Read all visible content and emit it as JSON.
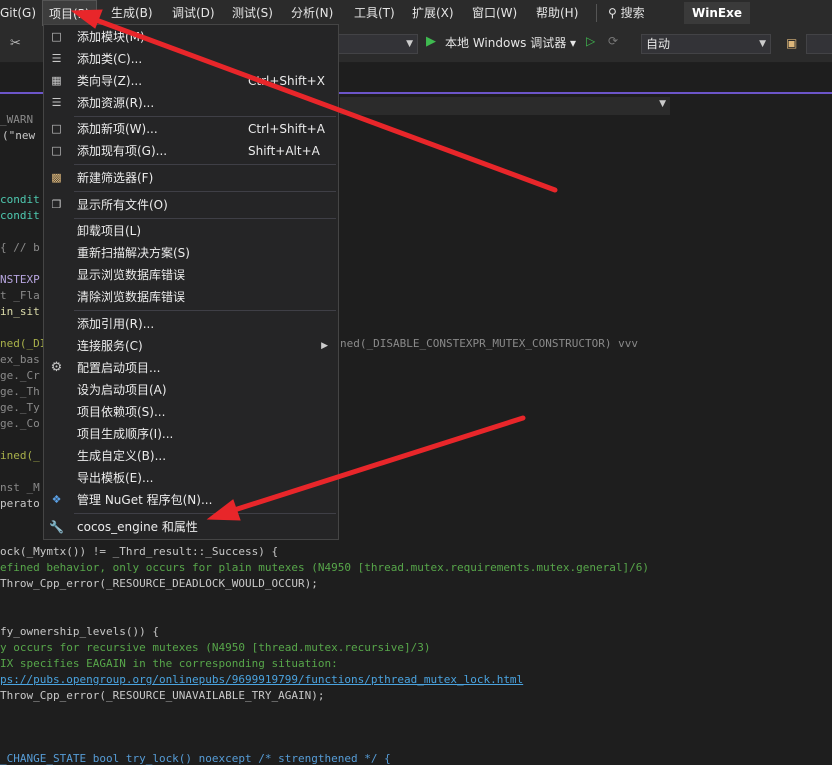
{
  "menubar": {
    "items": [
      {
        "label": "Git(G)",
        "active": false
      },
      {
        "label": "项目(P)",
        "active": true
      },
      {
        "label": "生成(B)",
        "active": false
      },
      {
        "label": "调试(D)",
        "active": false
      },
      {
        "label": "测试(S)",
        "active": false
      },
      {
        "label": "分析(N)",
        "active": false
      },
      {
        "label": "工具(T)",
        "active": false
      },
      {
        "label": "扩展(X)",
        "active": false
      },
      {
        "label": "窗口(W)",
        "active": false
      },
      {
        "label": "帮助(H)",
        "active": false
      }
    ],
    "search_label": "搜索",
    "search_icon": "search-icon",
    "solution_name": "WinExe"
  },
  "toolbar": {
    "debugger_label": "本地 Windows 调试器",
    "config_value": "自动"
  },
  "project_menu": {
    "items": [
      {
        "icon": "add-module-icon",
        "label": "添加模块(M)...",
        "shortcut": "",
        "submenu": false
      },
      {
        "icon": "add-class-icon",
        "label": "添加类(C)...",
        "shortcut": "",
        "submenu": false
      },
      {
        "icon": "class-wizard-icon",
        "label": "类向导(Z)...",
        "shortcut": "Ctrl+Shift+X",
        "submenu": false
      },
      {
        "icon": "add-resource-icon",
        "label": "添加资源(R)...",
        "shortcut": "",
        "submenu": false
      },
      {
        "icon": "add-new-item-icon",
        "label": "添加新项(W)...",
        "shortcut": "Ctrl+Shift+A",
        "submenu": false
      },
      {
        "icon": "add-existing-item-icon",
        "label": "添加现有项(G)...",
        "shortcut": "Shift+Alt+A",
        "submenu": false
      },
      {
        "icon": "new-filter-icon",
        "label": "新建筛选器(F)",
        "shortcut": "",
        "submenu": false
      },
      {
        "icon": "show-all-files-icon",
        "label": "显示所有文件(O)",
        "shortcut": "",
        "submenu": false
      },
      {
        "icon": "",
        "label": "卸载项目(L)",
        "shortcut": "",
        "submenu": false
      },
      {
        "icon": "",
        "label": "重新扫描解决方案(S)",
        "shortcut": "",
        "submenu": false
      },
      {
        "icon": "",
        "label": "显示浏览数据库错误",
        "shortcut": "",
        "submenu": false
      },
      {
        "icon": "",
        "label": "清除浏览数据库错误",
        "shortcut": "",
        "submenu": false
      },
      {
        "icon": "",
        "label": "添加引用(R)...",
        "shortcut": "",
        "submenu": false
      },
      {
        "icon": "",
        "label": "连接服务(C)",
        "shortcut": "",
        "submenu": true
      },
      {
        "icon": "gear-icon",
        "label": "配置启动项目...",
        "shortcut": "",
        "submenu": false
      },
      {
        "icon": "",
        "label": "设为启动项目(A)",
        "shortcut": "",
        "submenu": false
      },
      {
        "icon": "",
        "label": "项目依赖项(S)...",
        "shortcut": "",
        "submenu": false
      },
      {
        "icon": "",
        "label": "项目生成顺序(I)...",
        "shortcut": "",
        "submenu": false
      },
      {
        "icon": "",
        "label": "生成自定义(B)...",
        "shortcut": "",
        "submenu": false
      },
      {
        "icon": "",
        "label": "导出模板(E)...",
        "shortcut": "",
        "submenu": false
      },
      {
        "icon": "nuget-icon",
        "label": "管理 NuGet 程序包(N)...",
        "shortcut": "",
        "submenu": false
      },
      {
        "icon": "wrench-icon",
        "label": "cocos_engine 和属性",
        "shortcut": "",
        "submenu": false
      }
    ]
  },
  "code_fragments": [
    "_WARN",
    "(\"new",
    "condit",
    "condit",
    "{ // b",
    "NSTEXP",
    "t _Fla",
    "in_sit",
    "ned(_DI",
    "ned(_DISABLE_CONSTEXPR_MUTEX_CONSTRUCTOR) vvv",
    "ex_bas",
    "ge._Cr",
    "ge._Th",
    "ge._Ty",
    "ge._Co",
    "ined(_",
    "nst _M",
    "perato",
    "ock(_Mymtx()) != _Thrd_result::_Success) {",
    "efined behavior, only occurs for plain mutexes (N4950 [thread.mutex.requirements.mutex.general]/6)",
    "Throw_Cpp_error(_RESOURCE_DEADLOCK_WOULD_OCCUR);",
    "fy_ownership_levels()) {",
    "y occurs for recursive mutexes (N4950 [thread.mutex.recursive]/3)",
    "IX specifies EAGAIN in the corresponding situation:",
    "ps://pubs.opengroup.org/onlinepubs/9699919799/functions/pthread_mutex_lock.html",
    "Throw_Cpp_error(_RESOURCE_UNAVAILABLE_TRY_AGAIN);",
    "_CHANGE_STATE bool try_lock() noexcept /* strengthened */ {"
  ],
  "annotation_color": "#e8262a"
}
